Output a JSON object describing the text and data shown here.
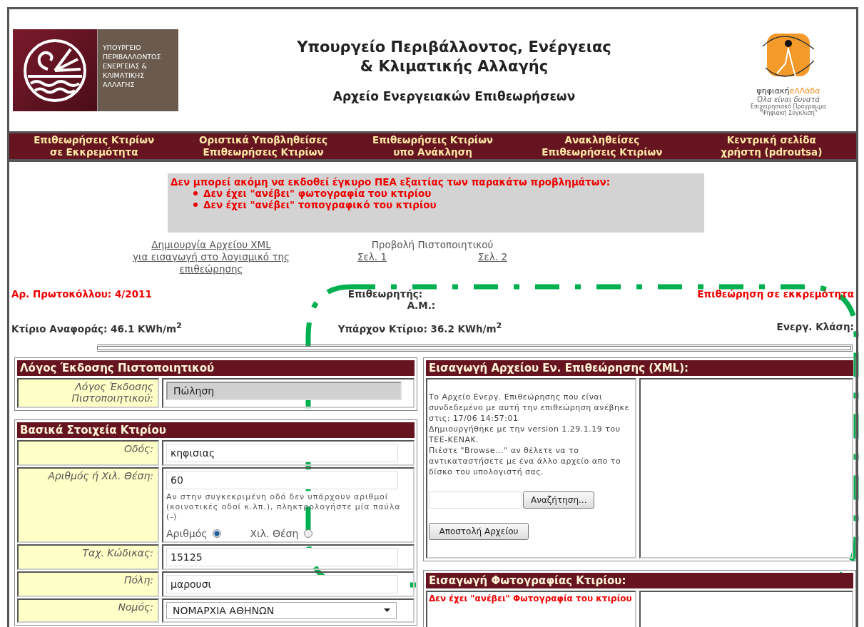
{
  "header": {
    "ministry_logo_lines": [
      "ΥΠΟΥΡΓΕΙΟ",
      "ΠΕΡΙΒΑΛΛΟΝΤΟΣ",
      "ΕΝΕΡΓΕΙΑΣ &",
      "ΚΛΙΜΑΤΙΚΗΣ",
      "ΑΛΛΑΓΗΣ"
    ],
    "title_lines": [
      "Υπουργείο Περιβάλλοντος, Ενέργειας",
      "& Κλιματικής Αλλαγής"
    ],
    "subtitle": "Αρχείο Ενεργειακών Επιθεωρήσεων",
    "program_logo": {
      "brand": [
        "ψηφιακή",
        "eΛΛάδα"
      ],
      "tagline": "Όλα είναι δυνατά",
      "small_lines": [
        "Επιχειρησιακό Πρόγραμμα",
        "\"Ψηφιακή Σύγκλιση\""
      ]
    }
  },
  "nav": [
    {
      "lines": [
        "Επιθεωρήσεις Κτιρίων",
        "σε Εκκρεμότητα"
      ]
    },
    {
      "lines": [
        "Οριστικά Υποβληθείσες",
        "Επιθεωρήσεις Κτιρίων"
      ]
    },
    {
      "lines": [
        "Επιθεωρήσεις Κτιρίων",
        "υπο Ανάκληση"
      ]
    },
    {
      "lines": [
        "Ανακληθείσες",
        "Επιθεωρήσεις Κτιρίων"
      ]
    },
    {
      "lines": [
        "Κεντρική σελίδα",
        "χρήστη (pdroutsa)"
      ]
    }
  ],
  "warning": {
    "title": "Δεν μπορεί ακόμη να εκδοθεί έγκυρο ΠΕΑ εξαιτίας των παρακάτω προβλημάτων:",
    "items": [
      "Δεν έχει \"ανέβει\" φωτογραφία του κτιρίου",
      "Δεν έχει \"ανέβει\" τοπογραφικό του κτιρίου"
    ]
  },
  "links": {
    "xml_link_lines": [
      "Δημιουργία Αρχείου XML",
      "για εισαγωγή στο λογισμικό της",
      "επιθεώρησης"
    ],
    "certificate": {
      "label": "Προβολή Πιστοποιητικού",
      "pages": [
        "Σελ. 1",
        "Σελ. 2"
      ]
    }
  },
  "info": {
    "protocol": "Αρ. Πρωτοκόλλου: 4/2011",
    "inspector": "Επιθεωρητής:",
    "am": "Α.Μ.:",
    "status": "Επιθεώρηση σε εκκρεμότητα",
    "reference": "Κτίριο Αναφοράς: 46.1 KWh/m$^{2}$",
    "existing": "Υπάρχον Κτίριο: 36.2 KWh/m$^{2}$",
    "energy_class": "Ενεργ. Κλάση:"
  },
  "left_panels": [
    {
      "title": "Λόγος Έκδοσης Πιστοποιητικού",
      "fields": [
        {
          "kind": "readonly",
          "label": "Λόγος Έκδοσης Πιστοποιητικού:",
          "value": "Πώληση"
        }
      ]
    },
    {
      "title": "Βασικά Στοιχεία Κτιρίου",
      "fields": [
        {
          "kind": "text",
          "label": "Οδός:",
          "value": "κηφισιας"
        },
        {
          "kind": "number",
          "label": "Αριθμός ή Χιλ. Θέση:",
          "value": "60",
          "hint": "Αν στην συγκεκριμένη οδό δεν υπάρχουν αριθμοί (κοινοτικές οδοί κ.λπ.), πληκτρολογήστε μία παύλα (-)",
          "options": [
            {
              "label": "Αριθμός",
              "selected": true
            },
            {
              "label": "Χιλ. Θέση",
              "selected": false
            }
          ]
        },
        {
          "kind": "text",
          "label": "Ταχ. Κώδικας:",
          "value": "15125"
        },
        {
          "kind": "text",
          "label": "Πόλη:",
          "value": "μαρουσι"
        },
        {
          "kind": "select",
          "label": "Νομός:",
          "value": "ΝΟΜΑΡΧΙΑ ΑΘΗΝΩΝ"
        }
      ]
    }
  ],
  "xml_panel": {
    "title": "Εισαγωγή Αρχείου Εν. Επιθεώρησης (XML):",
    "paragraphs": [
      "Το Αρχείο Ενεργ. Επιθεώρησης που είναι συνδεδεμένο με αυτή την επιθεώρηση ανέβηκε στις: 17/06 14:57:01",
      "Δημιουργήθηκε με την version 1.29.1.19 του ΤΕΕ-ΚΕΝΑΚ.",
      "Πιέστε \"Browse...\" αν θέλετε να το αντικαταστήσετε με ένα άλλο αρχείο απο το δίσκο του υπολογιστή σας."
    ],
    "browse_button": "Αναζήτηση...",
    "send_button": "Αποστολή Αρχείου"
  },
  "photo_panel": {
    "title": "Εισαγωγή Φωτογραφίας Κτιρίου:",
    "message": "Δεν έχει \"ανέβει\" Φωτογραφία του κτιρίου"
  }
}
